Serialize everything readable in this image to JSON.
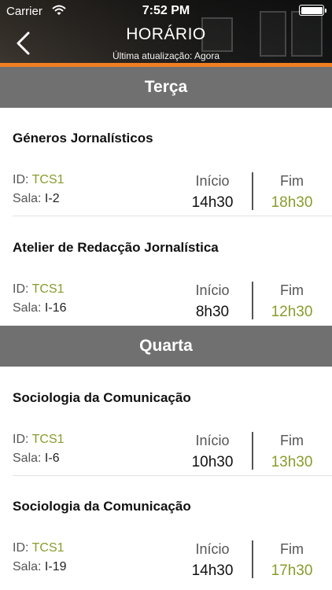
{
  "status": {
    "carrier": "Carrier",
    "time": "7:52 PM"
  },
  "nav": {
    "title": "HORÁRIO",
    "subtitle": "Última atualização: Agora"
  },
  "labels": {
    "id": "ID:",
    "sala": "Sala:",
    "inicio": "Início",
    "fim": "Fim"
  },
  "days": [
    {
      "name": "Terça",
      "courses": [
        {
          "name": "Géneros Jornalísticos",
          "id": "TCS1",
          "sala": "I-2",
          "inicio": "14h30",
          "fim": "18h30"
        },
        {
          "name": "Atelier de Redacção Jornalística",
          "id": "TCS1",
          "sala": "I-16",
          "inicio": "8h30",
          "fim": "12h30"
        }
      ]
    },
    {
      "name": "Quarta",
      "courses": [
        {
          "name": "Sociologia da Comunicação",
          "id": "TCS1",
          "sala": "I-6",
          "inicio": "10h30",
          "fim": "13h30"
        },
        {
          "name": "Sociologia da Comunicação",
          "id": "TCS1",
          "sala": "I-19",
          "inicio": "14h30",
          "fim": "17h30"
        }
      ]
    }
  ],
  "colors": {
    "accent": "#f07f22",
    "green": "#8a9b2c",
    "day_header": "#707070"
  }
}
